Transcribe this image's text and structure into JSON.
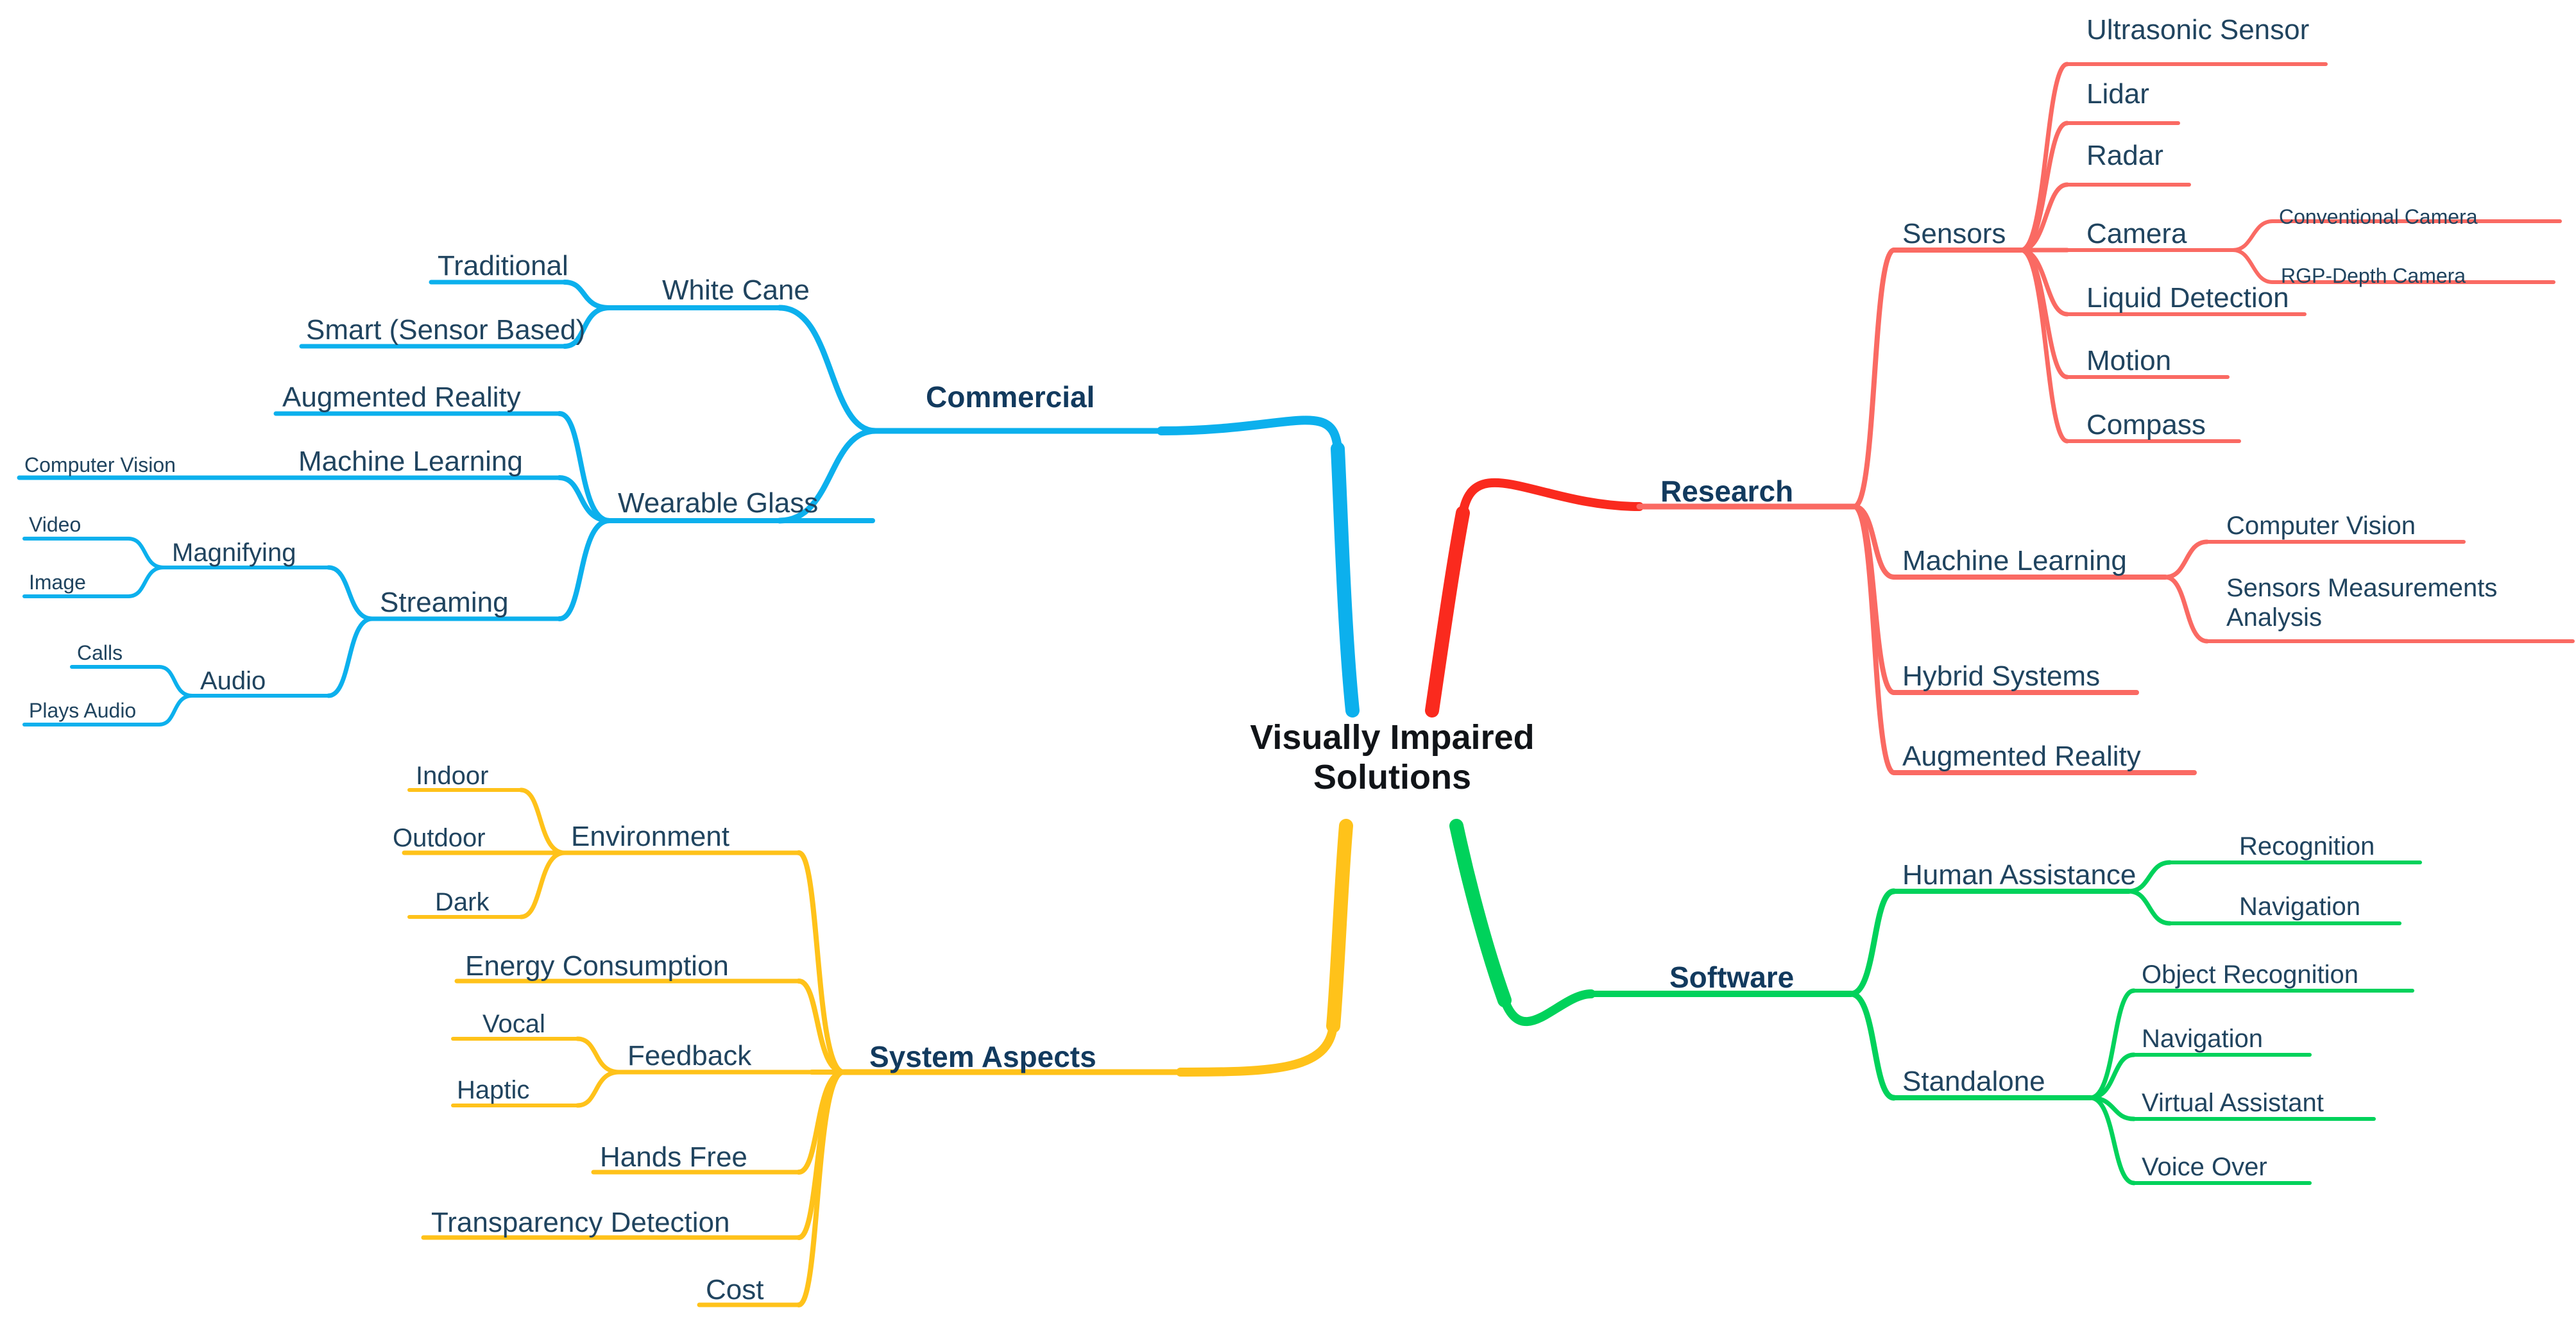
{
  "diagram": {
    "type": "mind-map",
    "title": "Visually Impaired Solutions",
    "center": {
      "label": "Visually Impaired\nSolutions",
      "line1": "Visually Impaired",
      "line2": "Solutions"
    },
    "colors": {
      "commercial": "#0CB0ED",
      "research": "#FA2A1E",
      "research_sub": "#FA6A63",
      "software": "#00D25B",
      "system_aspects": "#FFC21A",
      "branch_label": "#123a5e",
      "leaf_label": "#20445f",
      "center_label": "#111418",
      "background": "#ffffff"
    },
    "branches": [
      {
        "id": "commercial",
        "label": "Commercial",
        "color": "#0CB0ED",
        "side": "left",
        "children": [
          {
            "label": "White Cane",
            "children": [
              {
                "label": "Traditional"
              },
              {
                "label": "Smart (Sensor Based)"
              }
            ]
          },
          {
            "label": "Wearable Glass",
            "children": [
              {
                "label": "Augmented Reality"
              },
              {
                "label": "Machine Learning",
                "children": [
                  {
                    "label": "Computer Vision"
                  }
                ]
              },
              {
                "label": "Streaming",
                "children": [
                  {
                    "label": "Magnifying",
                    "children": [
                      {
                        "label": "Video"
                      },
                      {
                        "label": "Image"
                      }
                    ]
                  },
                  {
                    "label": "Audio",
                    "children": [
                      {
                        "label": "Calls"
                      },
                      {
                        "label": "Plays Audio"
                      }
                    ]
                  }
                ]
              }
            ]
          }
        ]
      },
      {
        "id": "system-aspects",
        "label": "System Aspects",
        "color": "#FFC21A",
        "side": "left",
        "children": [
          {
            "label": "Environment",
            "children": [
              {
                "label": "Indoor"
              },
              {
                "label": "Outdoor"
              },
              {
                "label": "Dark"
              }
            ]
          },
          {
            "label": "Energy Consumption"
          },
          {
            "label": "Feedback",
            "children": [
              {
                "label": "Vocal"
              },
              {
                "label": "Haptic"
              }
            ]
          },
          {
            "label": "Hands Free"
          },
          {
            "label": "Transparency Detection"
          },
          {
            "label": "Cost"
          }
        ]
      },
      {
        "id": "research",
        "label": "Research",
        "color": "#FA2A1E",
        "side": "right",
        "children": [
          {
            "label": "Sensors",
            "children": [
              {
                "label": "Ultrasonic Sensor"
              },
              {
                "label": "Lidar"
              },
              {
                "label": "Radar"
              },
              {
                "label": "Camera",
                "children": [
                  {
                    "label": "Conventional Camera"
                  },
                  {
                    "label": "RGP-Depth Camera"
                  }
                ]
              },
              {
                "label": "Liquid Detection"
              },
              {
                "label": "Motion"
              },
              {
                "label": "Compass"
              }
            ]
          },
          {
            "label": "Machine Learning",
            "children": [
              {
                "label": "Computer Vision"
              },
              {
                "label": "Sensors Measurements Analysis",
                "line1": "Sensors Measurements",
                "line2": "Analysis"
              }
            ]
          },
          {
            "label": "Hybrid Systems"
          },
          {
            "label": "Augmented Reality"
          }
        ]
      },
      {
        "id": "software",
        "label": "Software",
        "color": "#00D25B",
        "side": "right",
        "children": [
          {
            "label": "Human Assistance",
            "children": [
              {
                "label": "Recognition"
              },
              {
                "label": "Navigation"
              }
            ]
          },
          {
            "label": "Standalone",
            "children": [
              {
                "label": "Object Recognition"
              },
              {
                "label": "Navigation"
              },
              {
                "label": "Virtual Assistant"
              },
              {
                "label": "Voice Over"
              }
            ]
          }
        ]
      }
    ]
  }
}
